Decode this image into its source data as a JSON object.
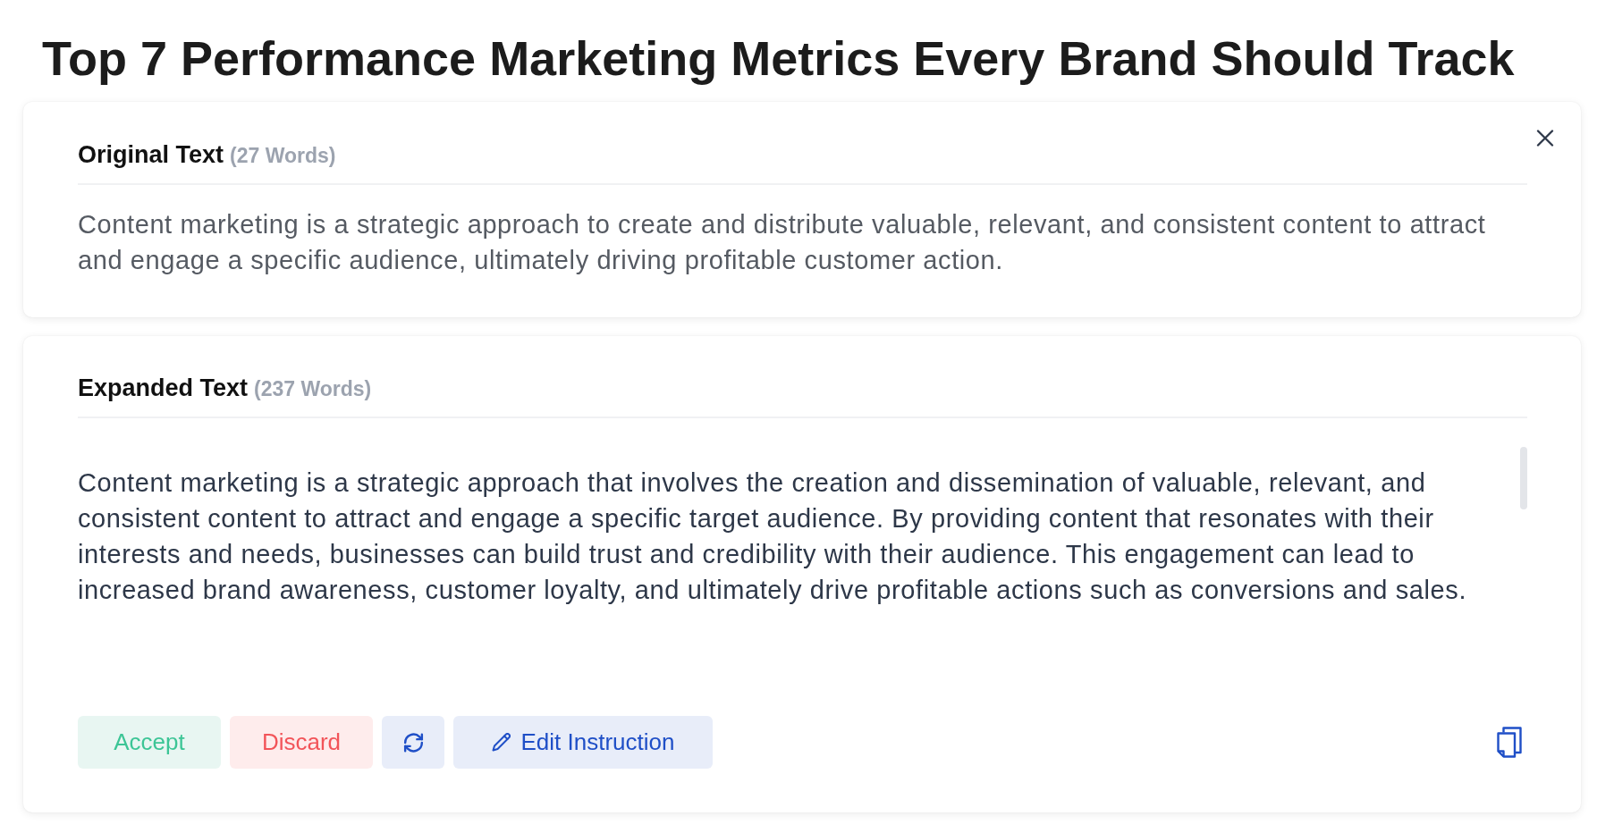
{
  "title": "Top 7 Performance Marketing Metrics Every Brand Should Track",
  "original": {
    "heading": "Original Text",
    "word_count": "(27 Words)",
    "text": "Content marketing is a strategic approach to create and distribute valuable, relevant, and consistent content to attract and engage a specific audience, ultimately driving profitable customer action."
  },
  "expanded": {
    "heading": "Expanded Text",
    "word_count": "(237 Words)",
    "text": "Content marketing is a strategic approach that involves the creation and dissemination of valuable, relevant, and consistent content to attract and engage a specific target audience. By providing content that resonates with their interests and needs, businesses can build trust and credibility with their audience. This engagement can lead to increased brand awareness, customer loyalty, and ultimately drive profitable actions such as conversions and sales."
  },
  "actions": [
    {
      "kind": "accept",
      "label": "Accept"
    },
    {
      "kind": "discard",
      "label": "Discard"
    },
    {
      "kind": "regenerate"
    },
    {
      "kind": "edit",
      "label": "Edit Instruction"
    }
  ]
}
